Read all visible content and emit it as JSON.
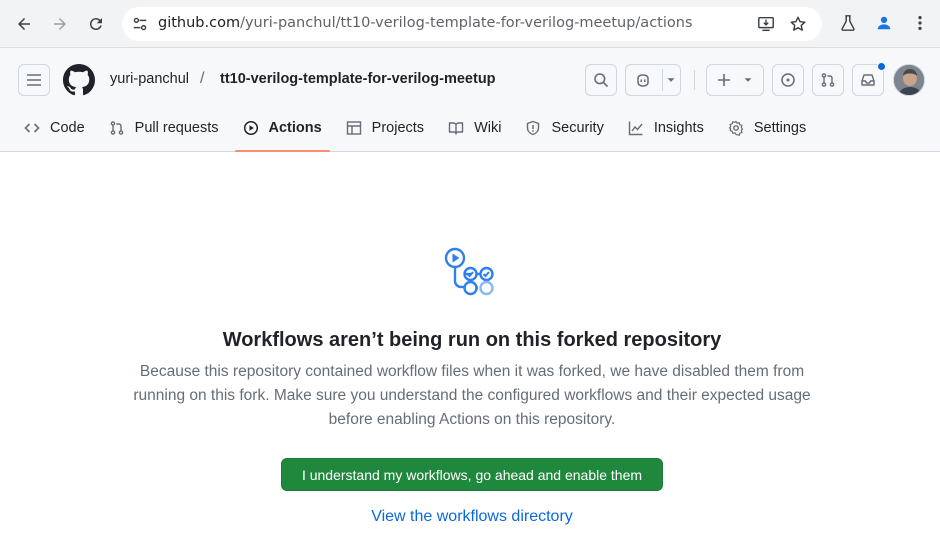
{
  "browser": {
    "url_host": "github.com",
    "url_path": "/yuri-panchul/tt10-verilog-template-for-verilog-meetup/actions",
    "icons": [
      "back-icon",
      "forward-icon",
      "reload-icon",
      "site-info-icon",
      "install-app-icon",
      "bookmark-star-icon",
      "labs-flask-icon",
      "profile-icon",
      "menu-kebab-icon"
    ]
  },
  "header": {
    "owner": "yuri-panchul",
    "separator": "/",
    "repo": "tt10-verilog-template-for-verilog-meetup"
  },
  "tabs": [
    {
      "label": "Code",
      "icon": "code-icon"
    },
    {
      "label": "Pull requests",
      "icon": "pull-request-icon"
    },
    {
      "label": "Actions",
      "icon": "play-icon",
      "active": true
    },
    {
      "label": "Projects",
      "icon": "table-icon"
    },
    {
      "label": "Wiki",
      "icon": "book-icon"
    },
    {
      "label": "Security",
      "icon": "shield-icon"
    },
    {
      "label": "Insights",
      "icon": "graph-icon"
    },
    {
      "label": "Settings",
      "icon": "gear-icon"
    }
  ],
  "main": {
    "title": "Workflows aren’t being run on this forked repository",
    "description": "Because this repository contained workflow files when it was forked, we have disabled them from running on this fork. Make sure you understand the configured workflows and their expected usage before enabling Actions on this repository.",
    "enable_button": "I understand my workflows, go ahead and enable them",
    "directory_link": "View the workflows directory"
  },
  "colors": {
    "accent_link": "#0969da",
    "primary_button": "#1f883d",
    "active_tab_underline": "#fd8c73",
    "workflow_icon": "#2f80ed"
  }
}
